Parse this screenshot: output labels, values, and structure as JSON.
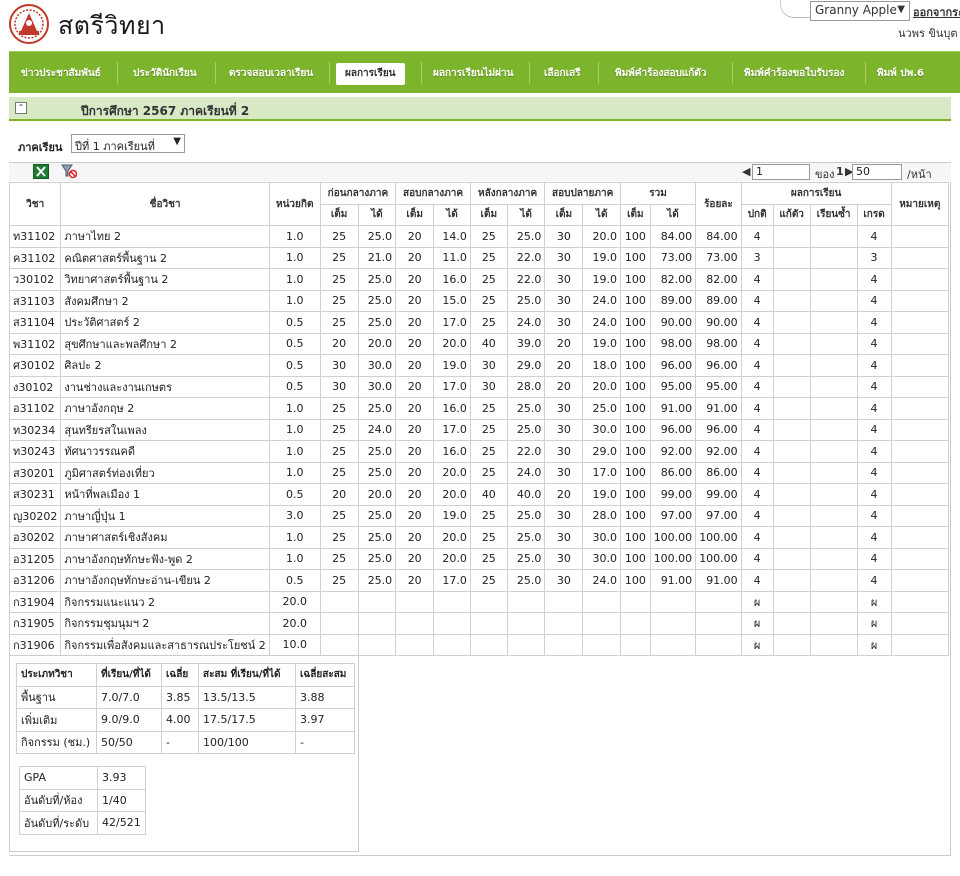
{
  "header": {
    "site_name": "สตรีวิทยา",
    "user_select": "Granny Apple",
    "logout": "ออกจากระ",
    "user_name": "นวพร ขินบุต"
  },
  "nav": [
    "ข่าวประชาสัมพันธ์",
    "ประวัตินักเรียน",
    "ตรวจสอบเวลาเรียน",
    "ผลการเรียน",
    "ผลการเรียนไม่ผ่าน",
    "เลือกเสรี",
    "พิมพ์คำร้องสอบแก้ตัว",
    "พิมพ์คำร้องขอใบรับรอง",
    "พิมพ์ ปพ.6"
  ],
  "nav_active": "ผลการเรียน",
  "section_title": "ปีการศึกษา 2567 ภาคเรียนที่ 2",
  "semester": {
    "label": "ภาคเรียน",
    "value": "ปีที่ 1 ภาคเรียนที่"
  },
  "pager": {
    "page": "1",
    "of_label": "ของ",
    "total": "1",
    "per_page": "50",
    "per_label": "/หน้า"
  },
  "table": {
    "h_code": "วิชา",
    "h_name": "ชื่อวิชา",
    "h_credit": "หน่วยกิต",
    "g_before": "ก่อนกลางภาค",
    "g_mid": "สอบกลางภาค",
    "g_after": "หลังกลางภาค",
    "g_final": "สอบปลายภาค",
    "g_total": "รวม",
    "h_percent": "ร้อยละ",
    "g_result": "ผลการเรียน",
    "h_note": "หมายเหตุ",
    "h_full": "เต็ม",
    "h_got": "ได้",
    "h_normal": "ปกติ",
    "h_retest": "แก้ตัว",
    "h_repeat": "เรียนซ้ำ",
    "h_grade": "เกรด",
    "rows": [
      [
        "ท31102",
        "ภาษาไทย 2",
        "1.0",
        "25",
        "25.0",
        "20",
        "14.0",
        "25",
        "25.0",
        "30",
        "20.0",
        "100",
        "84.00",
        "84.00",
        "4",
        "",
        "",
        "4",
        ""
      ],
      [
        "ค31102",
        "คณิตศาสตร์พื้นฐาน 2",
        "1.0",
        "25",
        "21.0",
        "20",
        "11.0",
        "25",
        "22.0",
        "30",
        "19.0",
        "100",
        "73.00",
        "73.00",
        "3",
        "",
        "",
        "3",
        ""
      ],
      [
        "ว30102",
        "วิทยาศาสตร์พื้นฐาน 2",
        "1.0",
        "25",
        "25.0",
        "20",
        "16.0",
        "25",
        "22.0",
        "30",
        "19.0",
        "100",
        "82.00",
        "82.00",
        "4",
        "",
        "",
        "4",
        ""
      ],
      [
        "ส31103",
        "สังคมศึกษา 2",
        "1.0",
        "25",
        "25.0",
        "20",
        "15.0",
        "25",
        "25.0",
        "30",
        "24.0",
        "100",
        "89.00",
        "89.00",
        "4",
        "",
        "",
        "4",
        ""
      ],
      [
        "ส31104",
        "ประวัติศาสตร์ 2",
        "0.5",
        "25",
        "25.0",
        "20",
        "17.0",
        "25",
        "24.0",
        "30",
        "24.0",
        "100",
        "90.00",
        "90.00",
        "4",
        "",
        "",
        "4",
        ""
      ],
      [
        "พ31102",
        "สุขศึกษาและพลศึกษา 2",
        "0.5",
        "20",
        "20.0",
        "20",
        "20.0",
        "40",
        "39.0",
        "20",
        "19.0",
        "100",
        "98.00",
        "98.00",
        "4",
        "",
        "",
        "4",
        ""
      ],
      [
        "ศ30102",
        "ศิลปะ 2",
        "0.5",
        "30",
        "30.0",
        "20",
        "19.0",
        "30",
        "29.0",
        "20",
        "18.0",
        "100",
        "96.00",
        "96.00",
        "4",
        "",
        "",
        "4",
        ""
      ],
      [
        "ง30102",
        "งานช่างและงานเกษตร",
        "0.5",
        "30",
        "30.0",
        "20",
        "17.0",
        "30",
        "28.0",
        "20",
        "20.0",
        "100",
        "95.00",
        "95.00",
        "4",
        "",
        "",
        "4",
        ""
      ],
      [
        "อ31102",
        "ภาษาอังกฤษ 2",
        "1.0",
        "25",
        "25.0",
        "20",
        "16.0",
        "25",
        "25.0",
        "30",
        "25.0",
        "100",
        "91.00",
        "91.00",
        "4",
        "",
        "",
        "4",
        ""
      ],
      [
        "ท30234",
        "สุนทรียรสในเพลง",
        "1.0",
        "25",
        "24.0",
        "20",
        "17.0",
        "25",
        "25.0",
        "30",
        "30.0",
        "100",
        "96.00",
        "96.00",
        "4",
        "",
        "",
        "4",
        ""
      ],
      [
        "ท30243",
        "ทัศนาวรรณคดี",
        "1.0",
        "25",
        "25.0",
        "20",
        "16.0",
        "25",
        "22.0",
        "30",
        "29.0",
        "100",
        "92.00",
        "92.00",
        "4",
        "",
        "",
        "4",
        ""
      ],
      [
        "ส30201",
        "ภูมิศาสตร์ท่องเที่ยว",
        "1.0",
        "25",
        "25.0",
        "20",
        "20.0",
        "25",
        "24.0",
        "30",
        "17.0",
        "100",
        "86.00",
        "86.00",
        "4",
        "",
        "",
        "4",
        ""
      ],
      [
        "ส30231",
        "หน้าที่พลเมือง 1",
        "0.5",
        "20",
        "20.0",
        "20",
        "20.0",
        "40",
        "40.0",
        "20",
        "19.0",
        "100",
        "99.00",
        "99.00",
        "4",
        "",
        "",
        "4",
        ""
      ],
      [
        "ญ30202",
        "ภาษาญี่ปุ่น 1",
        "3.0",
        "25",
        "25.0",
        "20",
        "19.0",
        "25",
        "25.0",
        "30",
        "28.0",
        "100",
        "97.00",
        "97.00",
        "4",
        "",
        "",
        "4",
        ""
      ],
      [
        "อ30202",
        "ภาษาศาสตร์เชิงสังคม",
        "1.0",
        "25",
        "25.0",
        "20",
        "20.0",
        "25",
        "25.0",
        "30",
        "30.0",
        "100",
        "100.00",
        "100.00",
        "4",
        "",
        "",
        "4",
        ""
      ],
      [
        "อ31205",
        "ภาษาอังกฤษทักษะฟัง-พูด 2",
        "1.0",
        "25",
        "25.0",
        "20",
        "20.0",
        "25",
        "25.0",
        "30",
        "30.0",
        "100",
        "100.00",
        "100.00",
        "4",
        "",
        "",
        "4",
        ""
      ],
      [
        "อ31206",
        "ภาษาอังกฤษทักษะอ่าน-เขียน 2",
        "0.5",
        "25",
        "25.0",
        "20",
        "17.0",
        "25",
        "25.0",
        "30",
        "24.0",
        "100",
        "91.00",
        "91.00",
        "4",
        "",
        "",
        "4",
        ""
      ],
      [
        "ก31904",
        "กิจกรรมแนะแนว 2",
        "20.0",
        "",
        "",
        "",
        "",
        "",
        "",
        "",
        "",
        "",
        "",
        "",
        "ผ",
        "",
        "",
        "ผ",
        ""
      ],
      [
        "ก31905",
        "กิจกรรมชุมนุมฯ 2",
        "20.0",
        "",
        "",
        "",
        "",
        "",
        "",
        "",
        "",
        "",
        "",
        "",
        "ผ",
        "",
        "",
        "ผ",
        ""
      ],
      [
        "ก31906",
        "กิจกรรมเพื่อสังคมและสาธารณประโยชน์ 2",
        "10.0",
        "",
        "",
        "",
        "",
        "",
        "",
        "",
        "",
        "",
        "",
        "",
        "ผ",
        "",
        "",
        "ผ",
        ""
      ]
    ]
  },
  "summary": {
    "headers": [
      "ประเภทวิชา",
      "ที่เรียน/ที่ได้",
      "เฉลี่ย",
      "สะสม ที่เรียน/ที่ได้",
      "เฉลี่ยสะสม"
    ],
    "rows": [
      [
        "พื้นฐาน",
        "7.0/7.0",
        "3.85",
        "13.5/13.5",
        "3.88"
      ],
      [
        "เพิ่มเติม",
        "9.0/9.0",
        "4.00",
        "17.5/17.5",
        "3.97"
      ],
      [
        "กิจกรรม (ชม.)",
        "50/50",
        "-",
        "100/100",
        "-"
      ]
    ],
    "gpa_label": "GPA",
    "gpa": "3.93",
    "rank_room_label": "อันดับที่/ห้อง",
    "rank_room": "1/40",
    "rank_level_label": "อันดับที่/ระดับ",
    "rank_level": "42/521"
  }
}
